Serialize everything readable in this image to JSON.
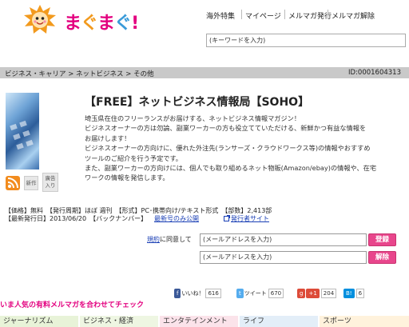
{
  "header": {
    "logo_text": "まぐまぐ!",
    "nav": [
      "海外特集",
      "マイページ",
      "メルマガ発行",
      "メルマガ解除"
    ],
    "search_placeholder": "(キーワードを入力)"
  },
  "breadcrumb": [
    "ビジネス・キャリア",
    "ネットビジネス",
    "その他"
  ],
  "breadcrumb_sep": " > ",
  "magazine": {
    "id": "ID:0001604313",
    "title": "【FREE】ネットビジネス情報局【SOHO】",
    "description": [
      "埼玉県在住のフリーランスがお届けする、ネットビジネス情報マガジン！",
      "ビジネスオーナーの方は勿論、副業ワーカーの方も役立てていただける、新鮮かつ有益な情報を",
      "お届けします！",
      "ビジネスオーナーの方向けに、優れた外注先(ランサーズ・クラウドワークス等)の情報やおすすめ",
      "ツールのご紹介を行う予定です。",
      "また、副業ワーカーの方向けには、個人でも取り組めるネット物販(Amazon/ebay)の情報や、在宅",
      "ワークの情報を発信します。"
    ],
    "badges": {
      "new": "新作",
      "ad": "廣告入り"
    },
    "meta_line1": "【価格】無料　【発行周期】ほぼ 週刊　【形式】PC･携帯向け/テキスト形式　【部数】2,413部",
    "meta_line2": "【最新発行日】2013/06/20　【バックナンバー】",
    "latest_issue_link": "最新号のみ公開",
    "publisher_link": "発行者サイト"
  },
  "subscribe": {
    "terms_link": "規約",
    "consent_text": "に同意して",
    "email_placeholder": "(メールアドレスを入力)",
    "register_label": "登録",
    "unsubscribe_label": "解除"
  },
  "social": {
    "like_label": "いいね！",
    "like_count": "616",
    "tweet_label": "ツイート",
    "tweet_count": "670",
    "gplus_label": "+1",
    "gplus_count": "204",
    "bi_label": "B!",
    "bi_count": "6"
  },
  "promo_text": "いま人気の有料メルマガを合わせてチェック",
  "categories": [
    "ジャーナリズム",
    "ビジネス・経済",
    "エンタテインメント",
    "ライフ",
    "スポーツ"
  ],
  "colors": {
    "accent_pink": "#e8468c",
    "promo_magenta": "#e3007f",
    "link_blue": "#1a3fb5",
    "breadcrumb_gray": "#c9c9c9"
  }
}
